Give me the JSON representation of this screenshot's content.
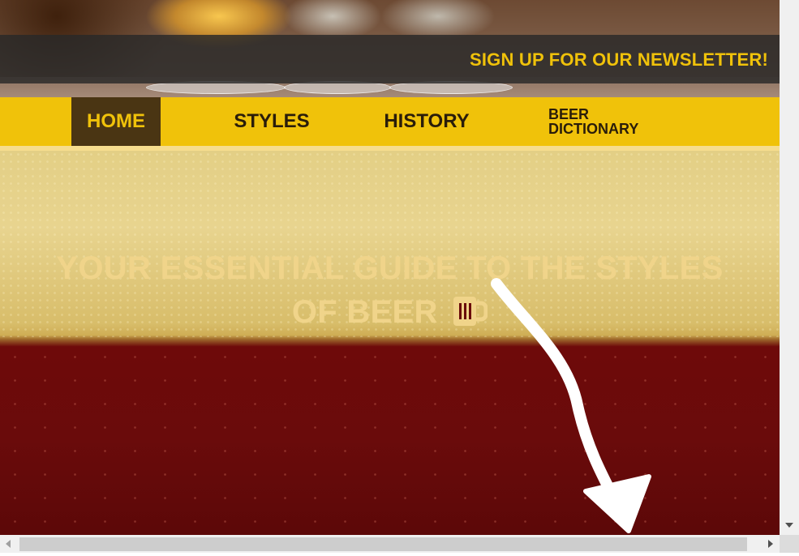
{
  "header": {
    "newsletter_label": "SIGN UP FOR OUR NEWSLETTER!"
  },
  "nav": {
    "items": [
      {
        "label": "HOME",
        "active": true
      },
      {
        "label": "STYLES"
      },
      {
        "label": "HISTORY"
      },
      {
        "label": "BEER DICTIONARY"
      }
    ]
  },
  "hero": {
    "title_line1": "YOUR ESSENTIAL GUIDE TO THE STYLES",
    "title_line2": "OF BEER",
    "icon": "beer-mug-icon"
  },
  "colors": {
    "accent": "#f0c20a",
    "nav_active_bg": "#4a3513",
    "hero_text": "#f0d48a"
  },
  "icons": {
    "scroll_down": "chevron-down-icon",
    "scroll_left": "chevron-left-icon",
    "scroll_right": "chevron-right-icon",
    "overlay_arrow": "curved-arrow-icon"
  }
}
